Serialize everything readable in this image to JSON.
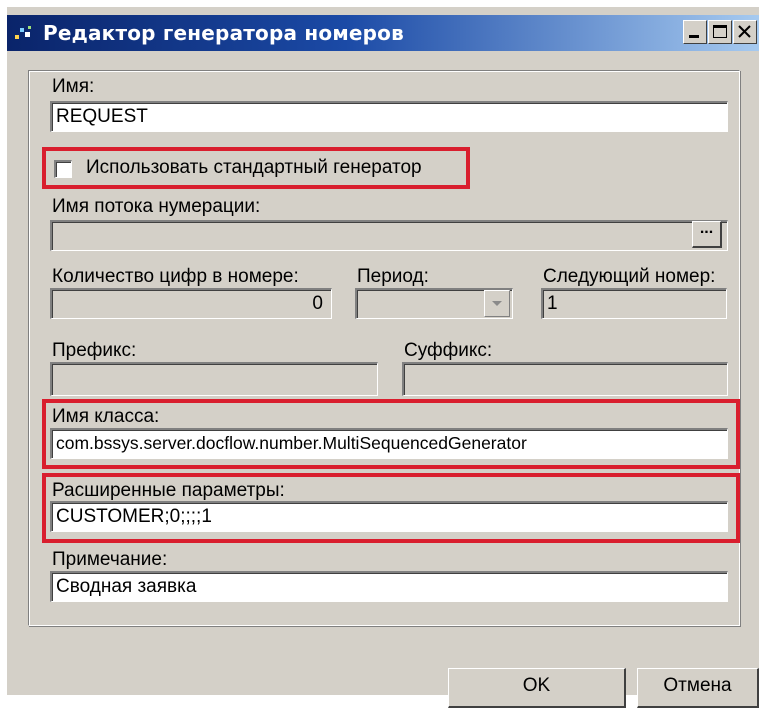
{
  "window": {
    "title": "Редактор генератора номеров"
  },
  "fields": {
    "name": {
      "label": "Имя:",
      "value": "REQUEST"
    },
    "use_standard_generator": {
      "label": "Использовать стандартный генератор",
      "checked": false
    },
    "numbering_stream": {
      "label": "Имя потока нумерации:",
      "value": ""
    },
    "digits_count": {
      "label": "Количество цифр в номере:",
      "value": "0"
    },
    "period": {
      "label": "Период:",
      "value": ""
    },
    "next_number": {
      "label": "Следующий номер:",
      "value": "1"
    },
    "prefix": {
      "label": "Префикс:",
      "value": ""
    },
    "suffix": {
      "label": "Суффикс:",
      "value": ""
    },
    "class_name": {
      "label": "Имя класса:",
      "value": "com.bssys.server.docflow.number.MultiSequencedGenerator"
    },
    "extended_params": {
      "label": "Расширенные параметры:",
      "value": "CUSTOMER;0;;;;1"
    },
    "note": {
      "label": "Примечание:",
      "value": "Сводная заявка"
    }
  },
  "buttons": {
    "ok": "OK",
    "cancel": "Отмена"
  },
  "colors": {
    "title_bar_start": "#0a246a",
    "title_bar_end": "#a6caf0",
    "highlight_box": "#d91e2e",
    "window_face": "#d4d0c8"
  }
}
